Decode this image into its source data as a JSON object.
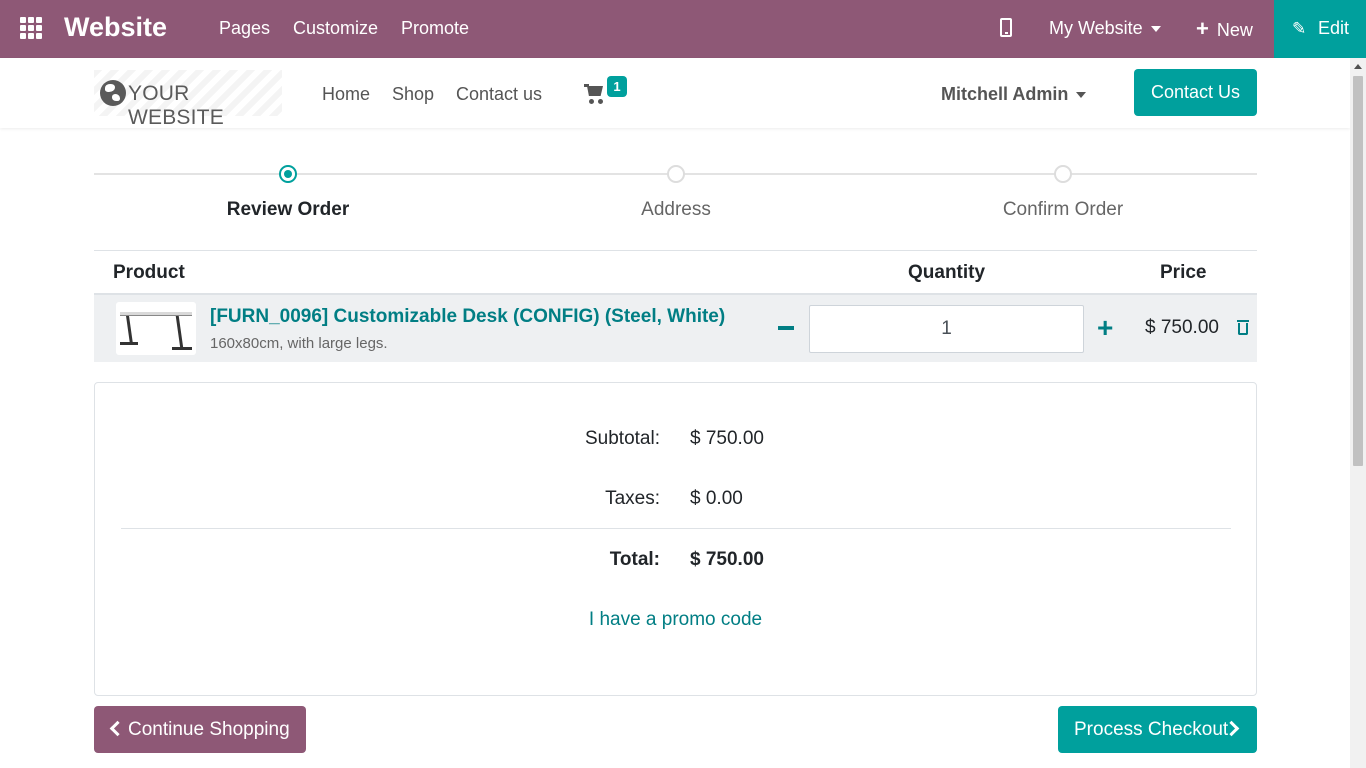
{
  "topbar": {
    "brand": "Website",
    "menu": [
      "Pages",
      "Customize",
      "Promote"
    ],
    "site_selector": "My Website",
    "new_label": "New",
    "edit_label": "Edit"
  },
  "header": {
    "logo_text": "YOUR WEBSITE",
    "nav": [
      "Home",
      "Shop",
      "Contact us"
    ],
    "cart_count": "1",
    "user": "Mitchell Admin",
    "contact_button": "Contact Us"
  },
  "wizard": {
    "steps": [
      "Review Order",
      "Address",
      "Confirm Order"
    ],
    "active_step": "Review Order"
  },
  "cart": {
    "columns": [
      "Product",
      "Quantity",
      "Price"
    ],
    "items": [
      {
        "name": "[FURN_0096] Customizable Desk (CONFIG) (Steel, White)",
        "description": "160x80cm, with large legs.",
        "quantity": "1",
        "price": "$ 750.00"
      }
    ]
  },
  "summary": {
    "subtotal_label": "Subtotal:",
    "subtotal": "$ 750.00",
    "taxes_label": "Taxes:",
    "taxes": "$ 0.00",
    "total_label": "Total:",
    "total": "$ 750.00",
    "promo_link": "I have a promo code"
  },
  "actions": {
    "continue": "Continue Shopping",
    "checkout": "Process Checkout"
  },
  "colors": {
    "admin_bar": "#8e5876",
    "accent": "#00a09d",
    "link": "#017e84"
  }
}
